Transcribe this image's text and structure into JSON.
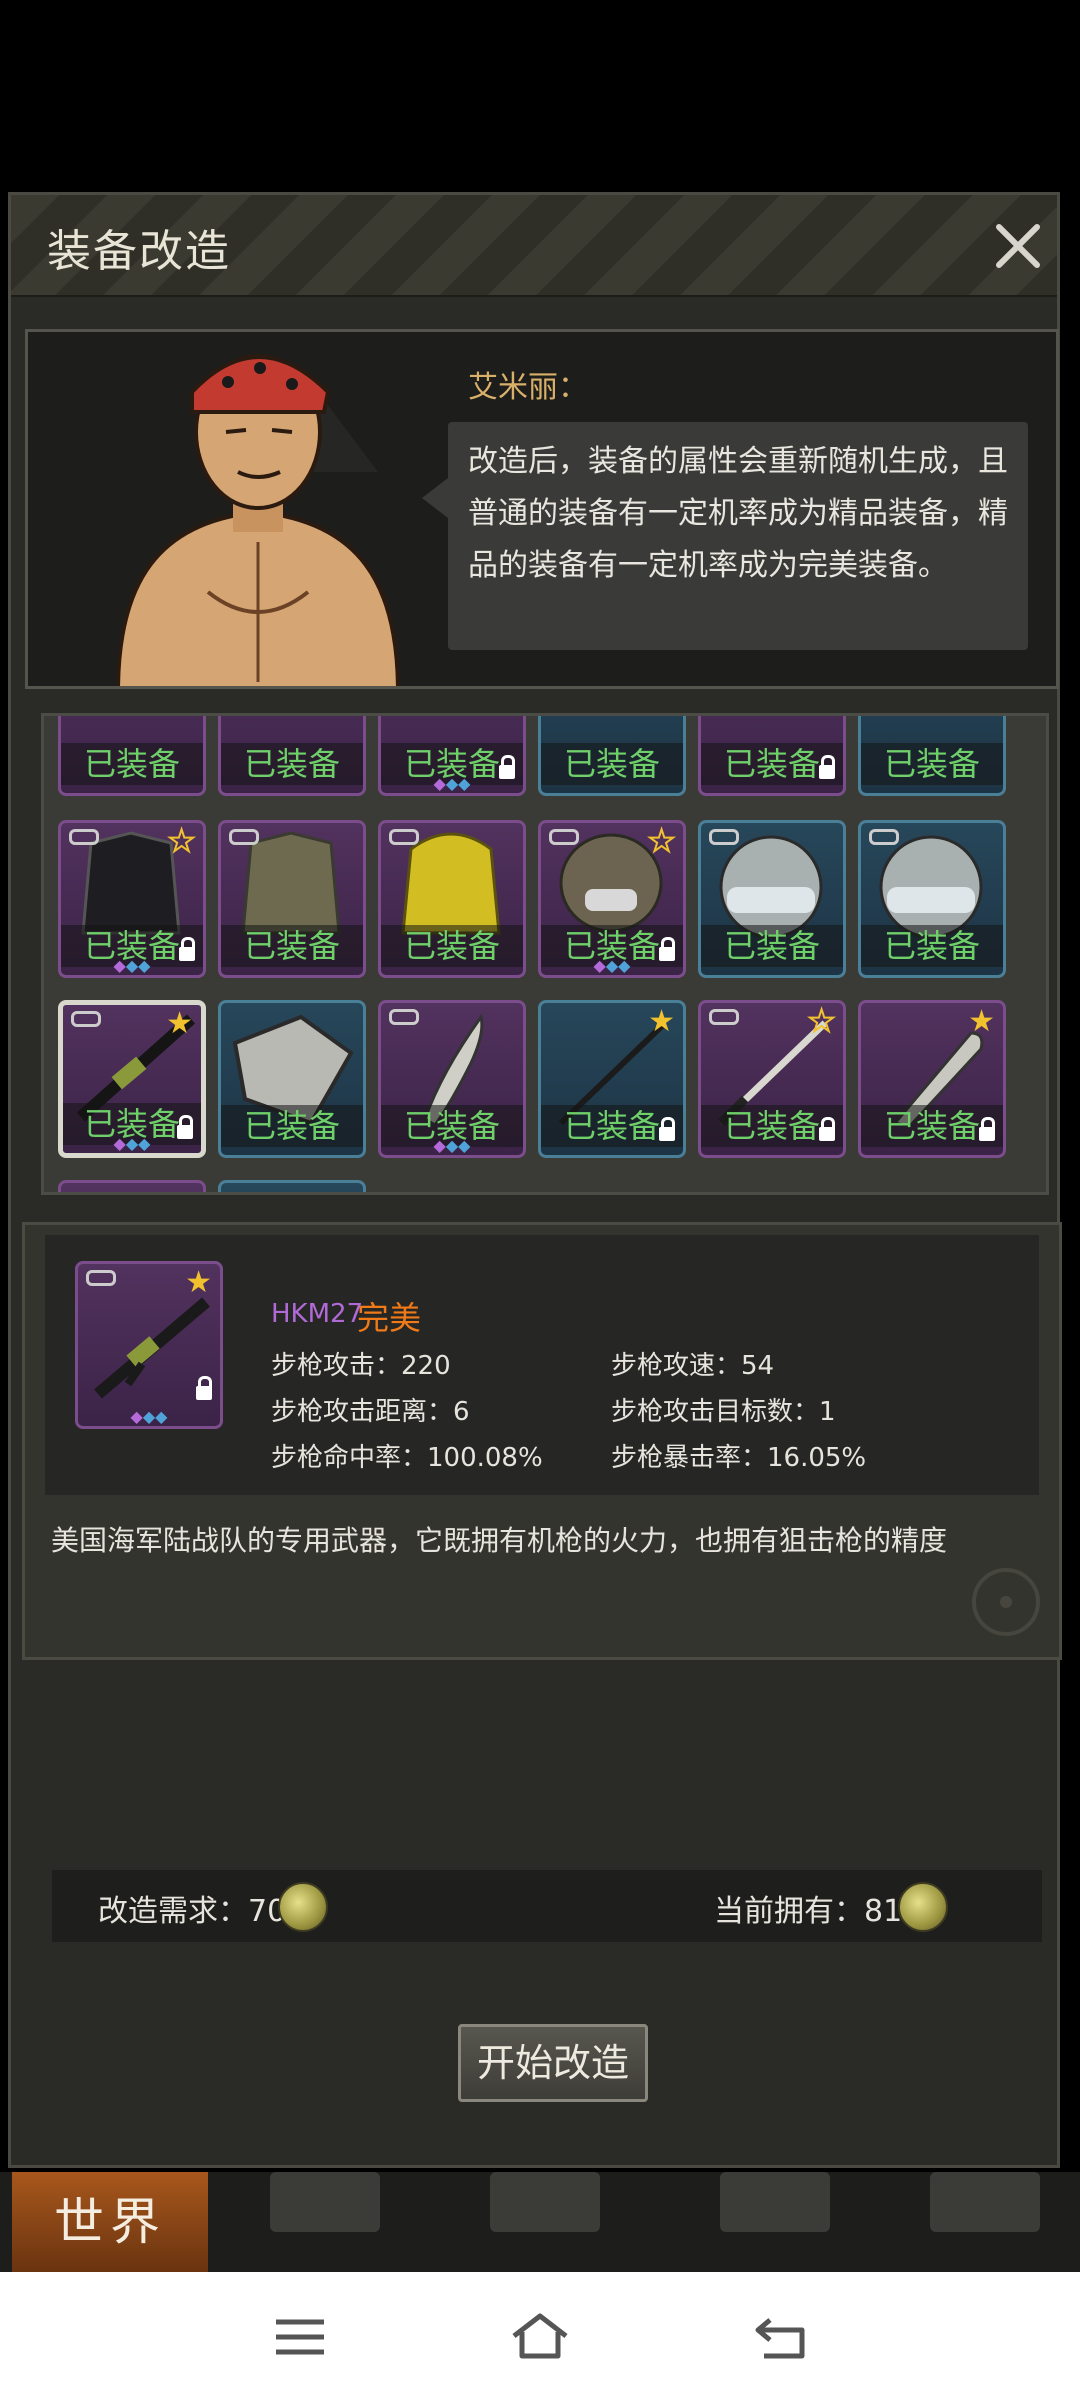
{
  "dialog": {
    "title": "装备改造",
    "close_icon": "close-icon"
  },
  "npc": {
    "name": "艾米丽：",
    "speech_lines": [
      "改造后，装备的属性会重新随机生成，且",
      "普通的装备有一定机率成为精品装备，精",
      "品的装备有一定机率成为完美装备。"
    ]
  },
  "grid": {
    "equipped_label": "已装备",
    "rows": [
      [
        {
          "color": "purple",
          "icon": "shirt-icon"
        },
        {
          "color": "purple",
          "icon": "shirt-icon"
        },
        {
          "color": "purple",
          "icon": "shirt-icon",
          "lock": true,
          "gems": "◆◆◆"
        },
        {
          "color": "blue",
          "icon": "shirt-icon"
        },
        {
          "color": "purple",
          "icon": "shirt-icon",
          "lock": true
        },
        {
          "color": "blue",
          "icon": "shirt-icon"
        }
      ],
      [
        {
          "color": "purple",
          "icon": "jacket-icon",
          "link": true,
          "star": "outline",
          "lock": true,
          "gems": "◆◆◆"
        },
        {
          "color": "purple",
          "icon": "fur-coat-icon",
          "link": true
        },
        {
          "color": "purple",
          "icon": "raincoat-icon",
          "link": true
        },
        {
          "color": "purple",
          "icon": "gas-mask-helmet-icon",
          "link": true,
          "star": "outline",
          "lock": true,
          "gems": "◆◆◆"
        },
        {
          "color": "blue",
          "icon": "helmet-icon",
          "link": true
        },
        {
          "color": "blue",
          "icon": "helmet-icon",
          "link": true
        }
      ],
      [
        {
          "color": "purple",
          "icon": "rifle-icon",
          "link": true,
          "star": "filled",
          "lock": true,
          "gems": "◆◆◆",
          "selected": true
        },
        {
          "color": "blue",
          "icon": "shield-icon"
        },
        {
          "color": "purple",
          "icon": "machete-icon",
          "link": true,
          "gems": "◆◆◆"
        },
        {
          "color": "blue",
          "icon": "spear-icon",
          "star": "filled",
          "lock": true
        },
        {
          "color": "purple",
          "icon": "katana-icon",
          "link": true,
          "star": "outline",
          "lock": true
        },
        {
          "color": "purple",
          "icon": "knife-icon",
          "star": "filled",
          "lock": true
        }
      ]
    ]
  },
  "detail": {
    "item_name": "HKM27",
    "quality": "完美",
    "stats": [
      {
        "label": "步枪攻击：220"
      },
      {
        "label": "步枪攻速：54"
      },
      {
        "label": "步枪攻击距离：6"
      },
      {
        "label": "步枪攻击目标数：1"
      },
      {
        "label": "步枪命中率：100.08%"
      },
      {
        "label": "步枪暴击率：16.05%"
      }
    ],
    "description": "美国海军陆战队的专用武器，它既拥有机枪的火力，也拥有狙击枪的精度"
  },
  "cost": {
    "required": "改造需求：70",
    "owned": "当前拥有：818"
  },
  "start_button": "开始改造",
  "game_nav": {
    "world": "世界"
  },
  "colors": {
    "equipped_green": "#6fd06a",
    "quality_orange": "#f07a18",
    "purple_name": "#b06ad6",
    "npc_name": "#d9b06a"
  }
}
